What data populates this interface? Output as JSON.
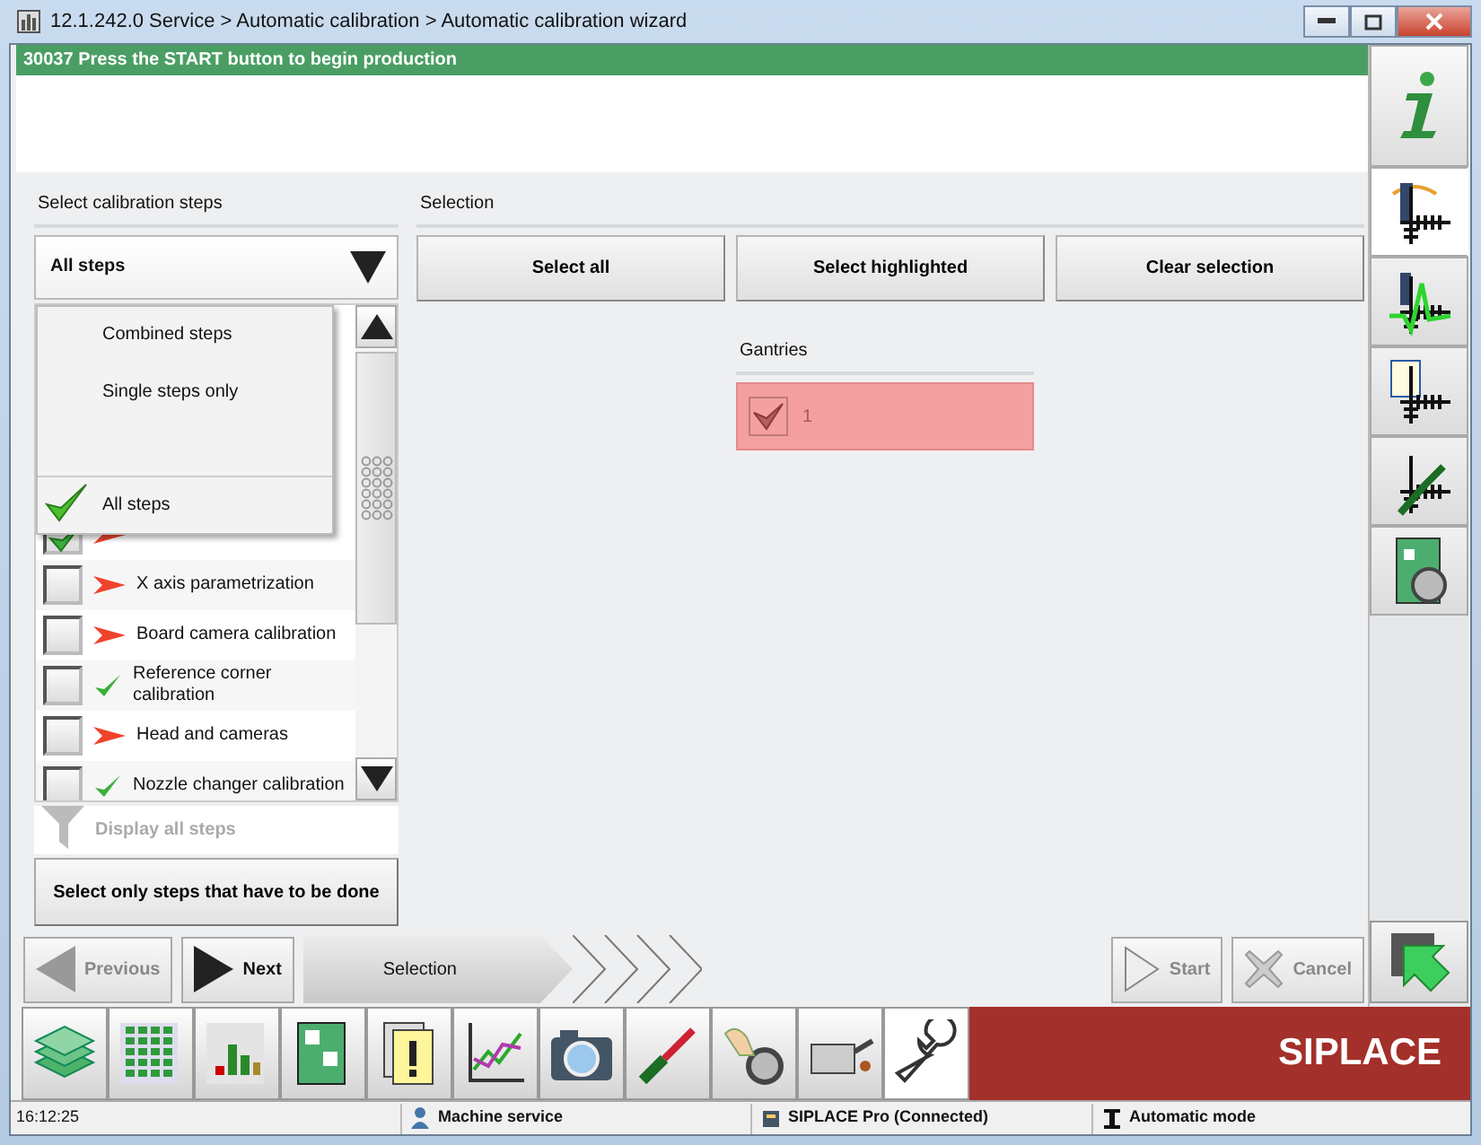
{
  "window": {
    "title": "12.1.242.0 Service > Automatic calibration > Automatic calibration wizard"
  },
  "message": {
    "text": "30037 Press the START button to begin production"
  },
  "steps_panel": {
    "heading": "Select calibration steps",
    "filter": {
      "value": "All steps"
    },
    "filter_menu": [
      {
        "label": "Combined steps",
        "selected": false
      },
      {
        "label": "Single steps only",
        "selected": false
      },
      {
        "label": "All steps",
        "selected": true
      }
    ],
    "steps": [
      {
        "checked": true,
        "done": false
      },
      {
        "label": "X axis parametrization",
        "checked": false,
        "done": false
      },
      {
        "label": "Board camera calibration",
        "checked": false,
        "done": false
      },
      {
        "label": "Reference corner calibration",
        "checked": false,
        "done": true
      },
      {
        "label": "Head and cameras",
        "checked": false,
        "done": false
      },
      {
        "label": "Nozzle changer calibration",
        "checked": false,
        "done": true
      }
    ],
    "display_all": {
      "label": "Display all steps",
      "disabled": true
    },
    "select_todo_button": "Select only steps that have to be done"
  },
  "selection_panel": {
    "heading": "Selection",
    "buttons": [
      "Select all",
      "Select highlighted",
      "Clear selection"
    ],
    "gantries_heading": "Gantries",
    "gantries": [
      {
        "label": "1",
        "checked": true,
        "highlighted": true
      }
    ]
  },
  "wizard": {
    "previous": {
      "label": "Previous",
      "disabled": true
    },
    "next": {
      "label": "Next",
      "disabled": false
    },
    "steps": [
      {
        "label": "Selection",
        "selected": true
      }
    ],
    "start": {
      "label": "Start",
      "disabled": true
    },
    "cancel": {
      "label": "Cancel",
      "disabled": true
    }
  },
  "side_tabs": [
    {
      "selected": true
    },
    {
      "selected": false
    },
    {
      "selected": false
    },
    {
      "selected": false
    },
    {
      "selected": false
    }
  ],
  "toolbar": [
    {
      "selected": false
    },
    {
      "selected": false
    },
    {
      "selected": false
    },
    {
      "selected": false
    },
    {
      "selected": false
    },
    {
      "selected": false
    },
    {
      "selected": false
    },
    {
      "selected": false
    },
    {
      "selected": false
    },
    {
      "selected": false
    },
    {
      "selected": true
    }
  ],
  "brand": "SIPLACE",
  "status_bar": {
    "time": "16:12:25",
    "items": [
      {
        "text": "Machine service",
        "kind": "user"
      },
      {
        "text": "SIPLACE Pro (Connected)",
        "kind": "server"
      },
      {
        "text": "Automatic mode",
        "kind": "mode"
      }
    ]
  }
}
